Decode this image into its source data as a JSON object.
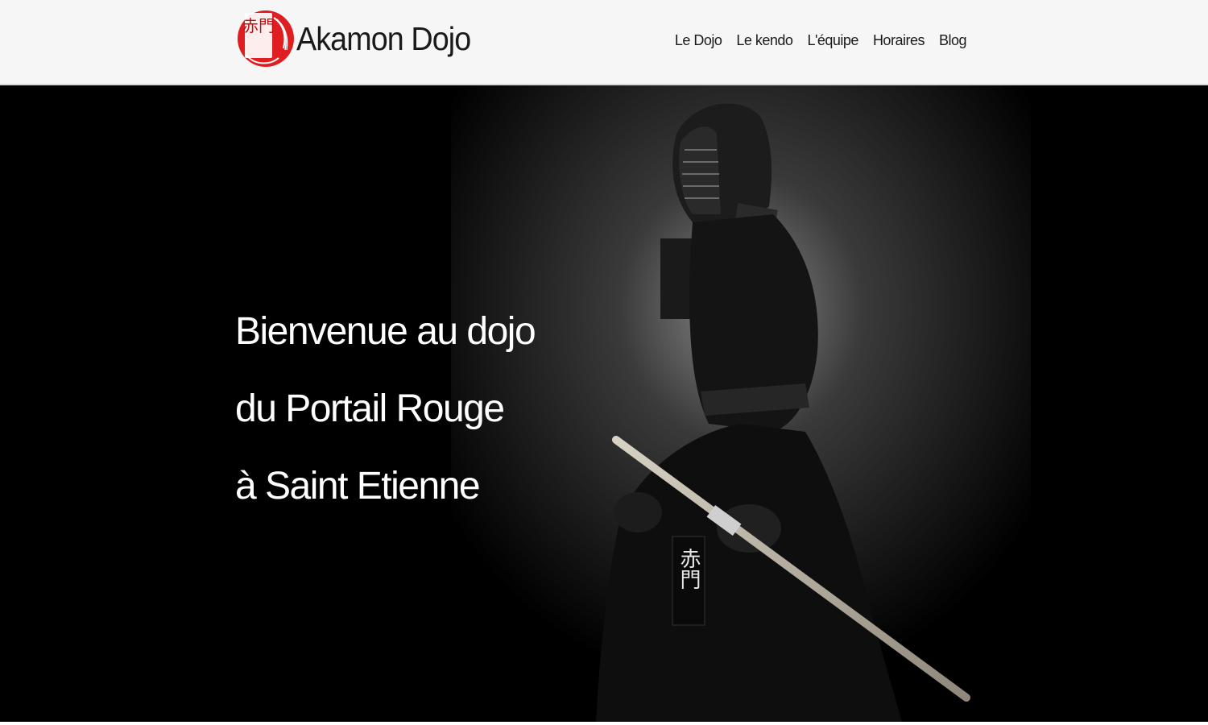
{
  "header": {
    "logo": {
      "text": "Akamon Dojo",
      "emblem_glyphs": "赤門",
      "emblem_color": "#e01e22"
    },
    "nav": [
      {
        "label": "Le Dojo"
      },
      {
        "label": "Le kendo"
      },
      {
        "label": "L'équipe"
      },
      {
        "label": "Horaires"
      },
      {
        "label": "Blog"
      }
    ]
  },
  "hero": {
    "title_lines": [
      "Bienvenue au dojo",
      "du Portail Rouge",
      "à Saint Etienne"
    ],
    "image": {
      "description_icon": "kendoka-photo",
      "banner_glyphs": "赤門"
    },
    "background": "#000000"
  }
}
